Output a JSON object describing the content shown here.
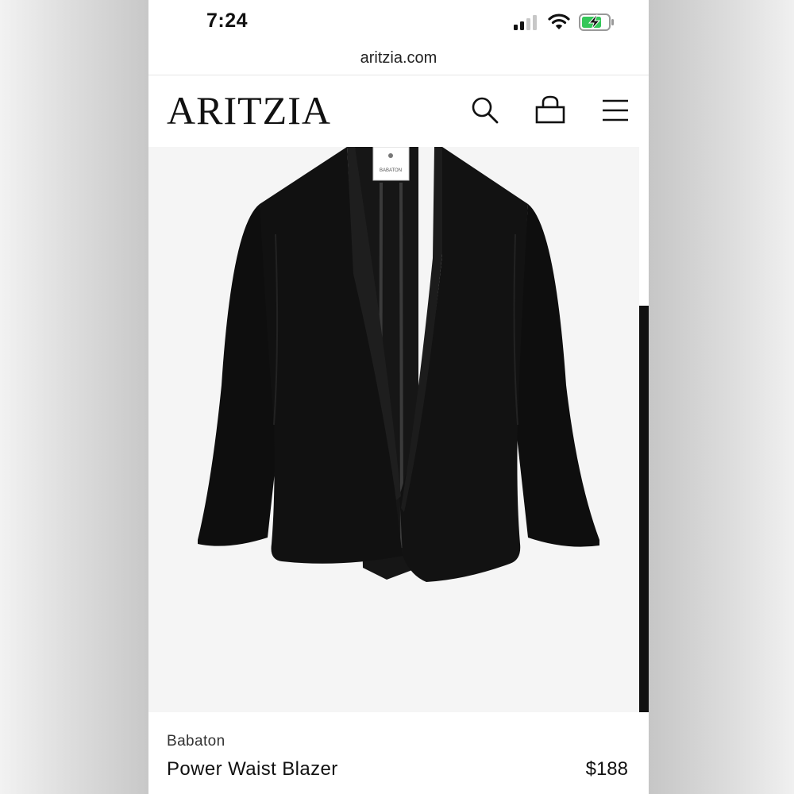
{
  "status_bar": {
    "time": "7:24",
    "icons": [
      "cellular-signal-icon",
      "wifi-icon",
      "battery-charging-icon"
    ]
  },
  "browser": {
    "url": "aritzia.com"
  },
  "header": {
    "logo": "ARITZIA",
    "icons": [
      "search-icon",
      "shopping-bag-icon",
      "hamburger-menu-icon"
    ]
  },
  "product": {
    "image_tag_text": "BABATON",
    "brand": "Babaton",
    "name": "Power Waist Blazer",
    "price": "$188"
  },
  "colors": {
    "text": "#111111",
    "battery_fill": "#34c759",
    "image_background": "#f5f5f5",
    "garment": "#0e0e0e"
  }
}
